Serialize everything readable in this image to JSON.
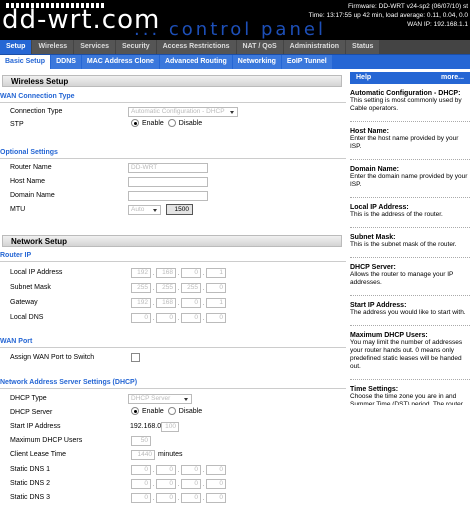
{
  "header": {
    "logo": "dd-wrt.com",
    "tagline": "... control panel",
    "firmware": "Firmware: DD-WRT v24-sp2 (06/07/10) st",
    "time": "Time: 13:17:55 up 42 min, load average: 0.11, 0.04, 0.0",
    "wan_ip": "WAN IP: 192.168.1.1"
  },
  "tabs": [
    "Setup",
    "Wireless",
    "Services",
    "Security",
    "Access Restrictions",
    "NAT / QoS",
    "Administration",
    "Status"
  ],
  "subtabs": [
    "Basic Setup",
    "DDNS",
    "MAC Address Clone",
    "Advanced Routing",
    "Networking",
    "EoIP Tunnel"
  ],
  "main": {
    "wireless_setup": "Wireless Setup",
    "wan_type_title": "WAN Connection Type",
    "connection_type_label": "Connection Type",
    "connection_type_value": "Automatic Configuration - DHCP",
    "stp_label": "STP",
    "enable": "Enable",
    "disable": "Disable",
    "optional_title": "Optional Settings",
    "router_name_label": "Router Name",
    "router_name_value": "DD-WRT",
    "host_name_label": "Host Name",
    "domain_name_label": "Domain Name",
    "mtu_label": "MTU",
    "mtu_mode": "Auto",
    "mtu_value": "1500",
    "network_setup": "Network Setup",
    "router_ip_title": "Router IP",
    "local_ip_label": "Local IP Address",
    "local_ip": [
      "192",
      "168",
      "0",
      "1"
    ],
    "subnet_label": "Subnet Mask",
    "subnet": [
      "255",
      "255",
      "255",
      "0"
    ],
    "gateway_label": "Gateway",
    "gateway": [
      "192",
      "168",
      "0",
      "1"
    ],
    "local_dns_label": "Local DNS",
    "local_dns": [
      "0",
      "0",
      "0",
      "0"
    ],
    "wan_port_title": "WAN Port",
    "assign_wan_label": "Assign WAN Port to Switch",
    "dhcp_title": "Network Address Server Settings (DHCP)",
    "dhcp_type_label": "DHCP Type",
    "dhcp_type_value": "DHCP Server",
    "dhcp_server_label": "DHCP Server",
    "start_ip_label": "Start IP Address",
    "start_ip_prefix": "192.168.0.",
    "start_ip_last": "100",
    "max_users_label": "Maximum DHCP Users",
    "max_users_value": "50",
    "lease_label": "Client Lease Time",
    "lease_value": "1440",
    "lease_unit": "minutes",
    "sdns1_label": "Static DNS 1",
    "sdns2_label": "Static DNS 2",
    "sdns3_label": "Static DNS 3",
    "sdns": [
      "0",
      "0",
      "0",
      "0"
    ]
  },
  "help": {
    "title": "Help",
    "more": "more...",
    "items": [
      {
        "title": "Automatic Configuration - DHCP:",
        "text": "This setting is most commonly used by Cable operators."
      },
      {
        "title": "Host Name:",
        "text": "Enter the host name provided by your ISP."
      },
      {
        "title": "Domain Name:",
        "text": "Enter the domain name provided by your ISP."
      },
      {
        "title": "Local IP Address:",
        "text": "This is the address of the router."
      },
      {
        "title": "Subnet Mask:",
        "text": "This is the subnet mask of the router."
      },
      {
        "title": "DHCP Server:",
        "text": "Allows the router to manage your IP addresses."
      },
      {
        "title": "Start IP Address:",
        "text": "The address you would like to start with."
      },
      {
        "title": "Maximum DHCP Users:",
        "text": "You may limit the number of addresses your router hands out. 0 means only predefined static leases will be handed out."
      },
      {
        "title": "Time Settings:",
        "text": "Choose the time zone you are in and Summer Time (DST) period. The router can use local time or UTC time."
      }
    ]
  }
}
